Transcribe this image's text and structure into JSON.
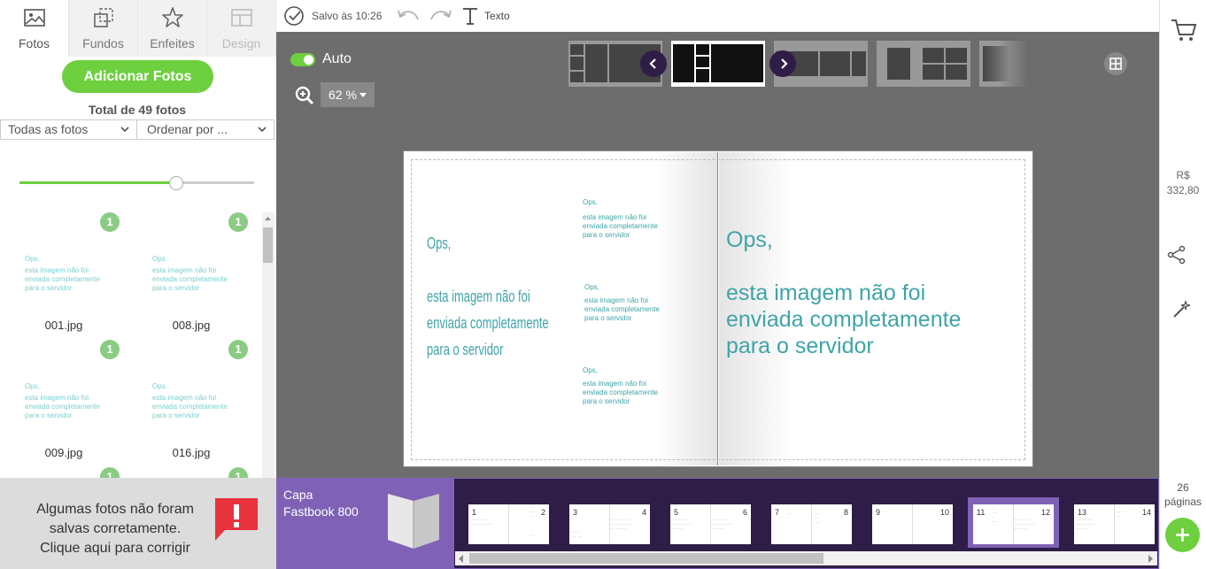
{
  "sidebar": {
    "tabs": [
      {
        "label": "Fotos",
        "icon": "image-icon"
      },
      {
        "label": "Fundos",
        "icon": "background-icon"
      },
      {
        "label": "Enfeites",
        "icon": "star-icon"
      },
      {
        "label": "Design",
        "icon": "layout-icon"
      }
    ],
    "add_photos": "Adicionar Fotos",
    "total": "Total de 49 fotos",
    "filter": "Todas as fotos",
    "sort": "Ordenar por ...",
    "photos": [
      {
        "name": "001.jpg",
        "count": "1"
      },
      {
        "name": "008.jpg",
        "count": "1"
      },
      {
        "name": "009.jpg",
        "count": "1"
      },
      {
        "name": "016.jpg",
        "count": "1"
      }
    ],
    "placeholder_ops": "Ops,",
    "placeholder_msg1": "esta imagem não foi",
    "placeholder_msg2": "enviada completamente",
    "placeholder_msg3": "para o servidor"
  },
  "warning": {
    "line1": "Algumas fotos não foram",
    "line2": "salvas corretamente.",
    "line3": "Clique aqui para corrigir"
  },
  "toolbar": {
    "saved": "Salvo às 10:26",
    "text": "Texto"
  },
  "editor": {
    "auto_label": "Auto",
    "zoom": "62 %"
  },
  "right": {
    "currency": "R$",
    "price": "332,80",
    "pages_count": "26",
    "pages_label": "páginas"
  },
  "strip": {
    "capa": "Capa",
    "product": "Fastbook 800",
    "pages": [
      {
        "a": "1",
        "b": "2"
      },
      {
        "a": "3",
        "b": "4"
      },
      {
        "a": "5",
        "b": "6"
      },
      {
        "a": "7",
        "b": "8"
      },
      {
        "a": "9",
        "b": "10"
      },
      {
        "a": "11",
        "b": "12"
      },
      {
        "a": "13",
        "b": "14"
      }
    ]
  },
  "colors": {
    "accent_green": "#6ecf3f",
    "purple": "#7f62b6",
    "dark_purple": "#2d1d47",
    "teal_text": "#3fa4a8",
    "warning_red": "#e8323c"
  }
}
